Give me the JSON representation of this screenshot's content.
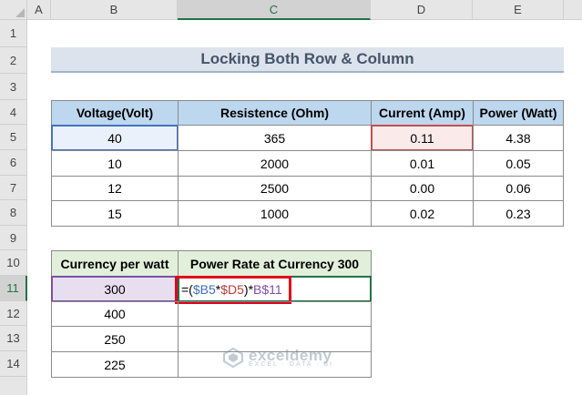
{
  "columns": [
    "A",
    "B",
    "C",
    "D",
    "E"
  ],
  "selected_column": "C",
  "rows": [
    "1",
    "2",
    "3",
    "4",
    "5",
    "6",
    "7",
    "8",
    "9",
    "10",
    "11",
    "12",
    "13",
    "14"
  ],
  "selected_row": "11",
  "title": "Locking Both Row & Column",
  "table1": {
    "headers": [
      "Voltage(Volt)",
      "Resistence (Ohm)",
      "Current (Amp)",
      "Power (Watt)"
    ],
    "rows": [
      [
        "40",
        "365",
        "0.11",
        "4.38"
      ],
      [
        "10",
        "2000",
        "0.01",
        "0.05"
      ],
      [
        "12",
        "2500",
        "0.00",
        "0.06"
      ],
      [
        "15",
        "1000",
        "0.02",
        "0.23"
      ]
    ]
  },
  "table2": {
    "headers": [
      "Currency per watt",
      "Power Rate at Currency 300"
    ],
    "rows": [
      [
        "300",
        ""
      ],
      [
        "400",
        ""
      ],
      [
        "250",
        ""
      ],
      [
        "225",
        ""
      ]
    ]
  },
  "formula_parts": {
    "p1": "=(",
    "p2": "$B5",
    "p3": "*",
    "p4": "$D5",
    "p5": ")*",
    "p6": "B$11"
  },
  "watermark": {
    "name": "exceldemy",
    "tagline": "EXCEL · DATA · BI"
  },
  "colors": {
    "header_blue": "#bdd7ee",
    "header_green": "#e2efda",
    "highlight_red": "#e0001b",
    "excel_green": "#217346"
  }
}
